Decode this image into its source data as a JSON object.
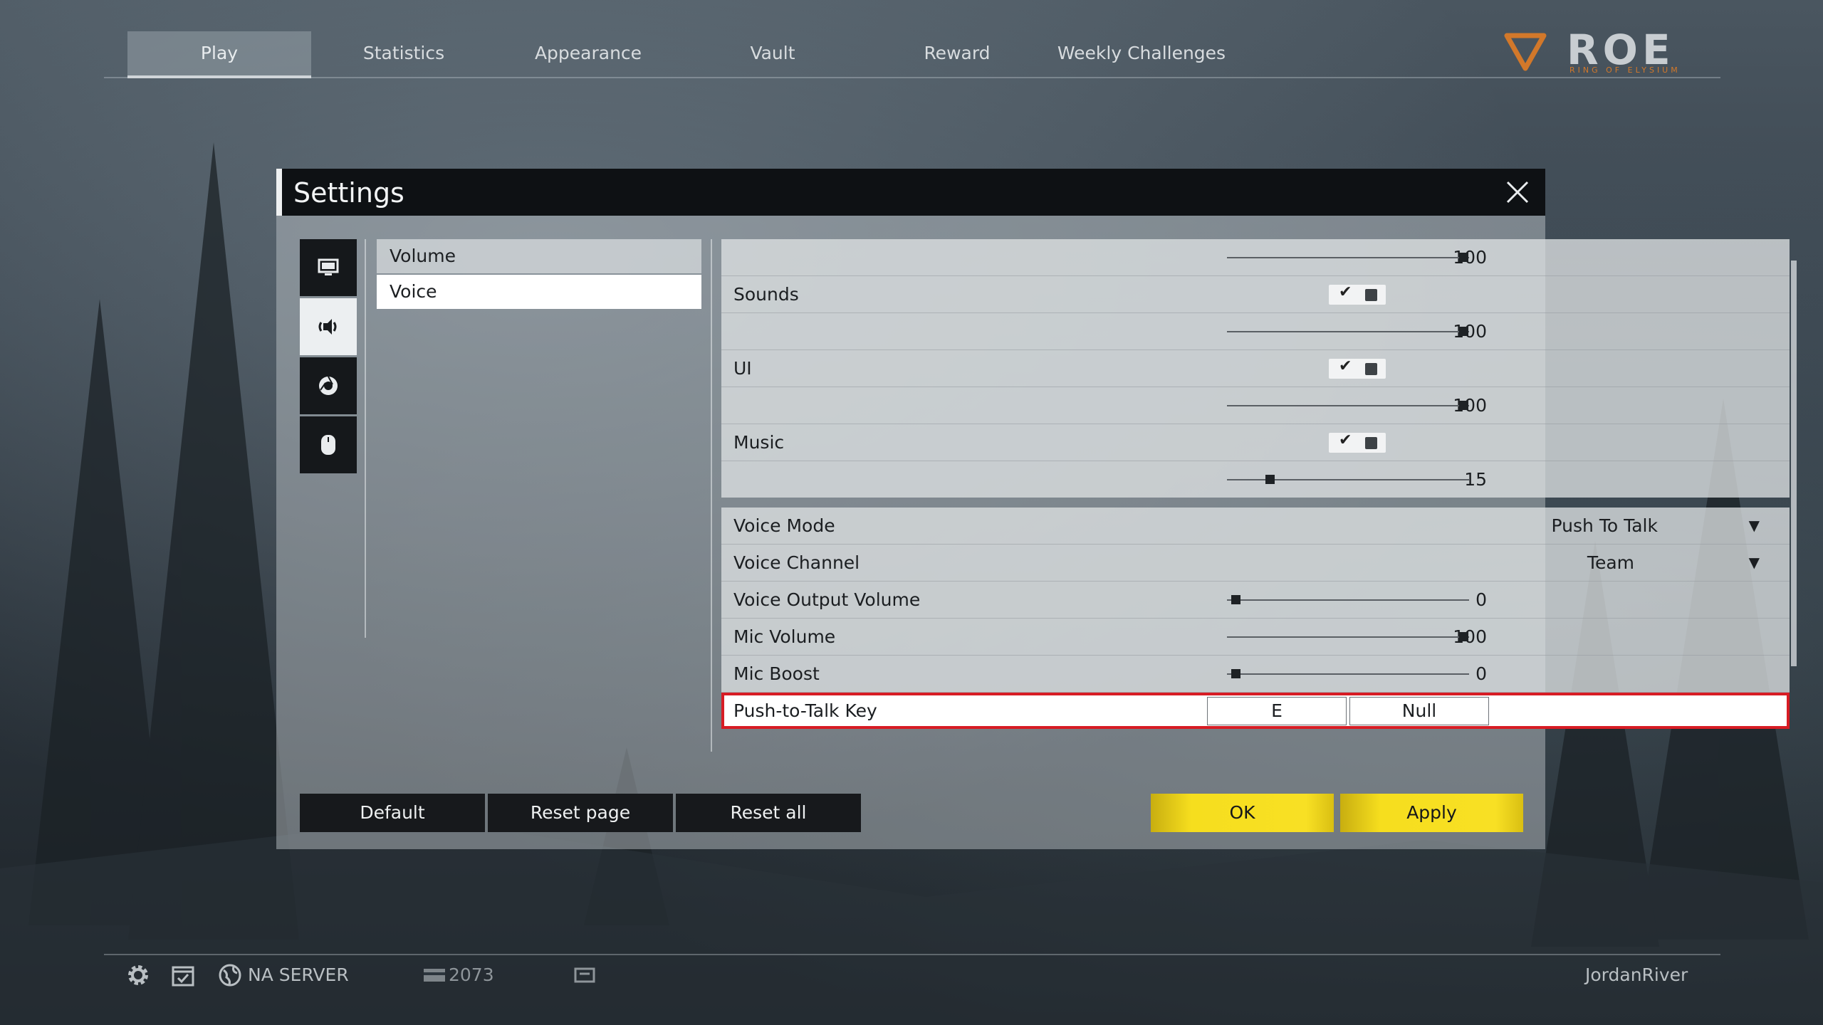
{
  "nav": {
    "tabs": [
      "Play",
      "Statistics",
      "Appearance",
      "Vault",
      "Reward",
      "Weekly Challenges"
    ],
    "active_tab": "Play"
  },
  "logo": {
    "word": "ROE",
    "tagline": "RING OF ELYSIUM"
  },
  "dialog": {
    "title": "Settings",
    "side_icons": [
      "monitor-icon",
      "speaker-icon",
      "chrome-icon",
      "mouse-icon"
    ],
    "categories": [
      "Volume",
      "Voice"
    ],
    "active_category": "Voice",
    "volume_rows": [
      {
        "label": "",
        "value": "100",
        "level": 1.0
      },
      {
        "label": "Sounds",
        "checked": true
      },
      {
        "label": "",
        "value": "100",
        "level": 1.0
      },
      {
        "label": "UI",
        "checked": true
      },
      {
        "label": "",
        "value": "100",
        "level": 1.0
      },
      {
        "label": "Music",
        "checked": true
      },
      {
        "label": "",
        "value": "15",
        "level": 0.15
      }
    ],
    "voice_rows": {
      "voice_mode": {
        "label": "Voice Mode",
        "value": "Push To Talk"
      },
      "voice_channel": {
        "label": "Voice Channel",
        "value": "Team"
      },
      "voice_output_volume": {
        "label": "Voice Output Volume",
        "value": "0",
        "level": 0.0
      },
      "mic_volume": {
        "label": "Mic Volume",
        "value": "100",
        "level": 1.0
      },
      "mic_boost": {
        "label": "Mic Boost",
        "value": "0",
        "level": 0.0
      },
      "push_to_talk": {
        "label": "Push-to-Talk Key",
        "primary": "E",
        "secondary": "Null"
      }
    },
    "buttons": {
      "default": "Default",
      "reset_page": "Reset page",
      "reset_all": "Reset all",
      "ok": "OK",
      "apply": "Apply"
    }
  },
  "bottom": {
    "server": "NA SERVER",
    "currency": "2073",
    "username": "JordanRiver"
  },
  "colors": {
    "accent_yellow": "#f6de1e",
    "highlight_red": "#d71c24",
    "logo_orange": "#d2782a"
  }
}
